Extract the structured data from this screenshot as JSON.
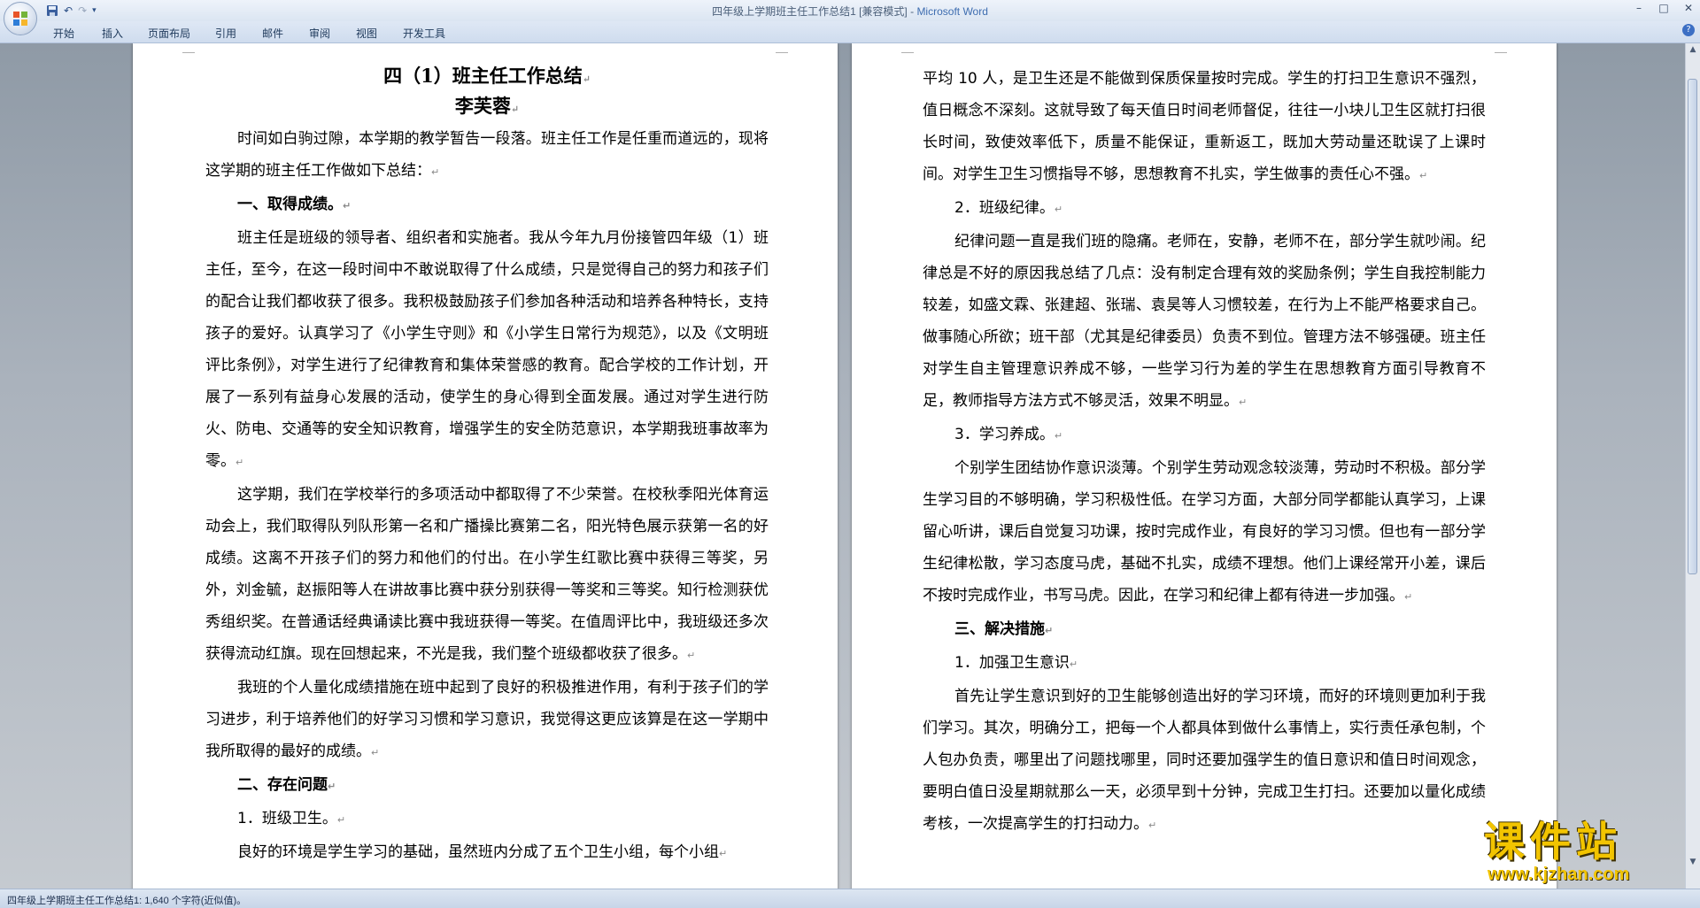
{
  "window": {
    "title": "四年级上学期班主任工作总结1 [兼容模式] - ",
    "app_name": "Microsoft Word",
    "controls": [
      "–",
      "□",
      "✕"
    ]
  },
  "quick_access": {
    "save_icon": "save-icon",
    "undo_icon": "undo-icon",
    "redo_icon": "redo-icon",
    "customize_icon": "customize-qat-icon"
  },
  "ribbon_tabs": [
    "开始",
    "插入",
    "页面布局",
    "引用",
    "邮件",
    "审阅",
    "视图",
    "开发工具"
  ],
  "document": {
    "left_page": {
      "title": "四（1）班主任工作总结",
      "author": "李芙蓉",
      "blocks": [
        {
          "type": "p",
          "text": "时间如白驹过隙，本学期的教学暂告一段落。班主任工作是任重而道远的，现将这学期的班主任工作做如下总结："
        },
        {
          "type": "h",
          "text": "一、取得成绩。"
        },
        {
          "type": "p",
          "text": "班主任是班级的领导者、组织者和实施者。我从今年九月份接管四年级（1）班主任，至今，在这一段时间中不敢说取得了什么成绩，只是觉得自己的努力和孩子们的配合让我们都收获了很多。我积极鼓励孩子们参加各种活动和培养各种特长，支持孩子的爱好。认真学习了《小学生守则》和《小学生日常行为规范》，以及《文明班评比条例》，对学生进行了纪律教育和集体荣誉感的教育。配合学校的工作计划，开展了一系列有益身心发展的活动，使学生的身心得到全面发展。通过对学生进行防火、防电、交通等的安全知识教育，增强学生的安全防范意识，本学期我班事故率为零。"
        },
        {
          "type": "p",
          "text": "这学期，我们在学校举行的多项活动中都取得了不少荣誉。在校秋季阳光体育运动会上，我们取得队列队形第一名和广播操比赛第二名，阳光特色展示获第一名的好成绩。这离不开孩子们的努力和他们的付出。在小学生红歌比赛中获得三等奖，另外，刘金毓，赵振阳等人在讲故事比赛中获分别获得一等奖和三等奖。知行检测获优秀组织奖。在普通话经典诵读比赛中我班获得一等奖。在值周评比中，我班级还多次获得流动红旗。现在回想起来，不光是我，我们整个班级都收获了很多。"
        },
        {
          "type": "p",
          "text": "我班的个人量化成绩措施在班中起到了良好的积极推进作用，有利于孩子们的学习进步，利于培养他们的好学习习惯和学习意识，我觉得这更应该算是在这一学期中我所取得的最好的成绩。"
        },
        {
          "type": "h",
          "text": "二、存在问题"
        },
        {
          "type": "h2",
          "text": "1．班级卫生。"
        },
        {
          "type": "p",
          "text": "良好的环境是学生学习的基础，虽然班内分成了五个卫生小组，每个小组"
        }
      ]
    },
    "right_page": {
      "blocks": [
        {
          "type": "p0",
          "text": "平均 10 人，是卫生还是不能做到保质保量按时完成。学生的打扫卫生意识不强烈，值日概念不深刻。这就导致了每天值日时间老师督促，往往一小块儿卫生区就打扫很长时间，致使效率低下，质量不能保证，重新返工，既加大劳动量还耽误了上课时间。对学生卫生习惯指导不够，思想教育不扎实，学生做事的责任心不强。"
        },
        {
          "type": "h2",
          "text": "2．班级纪律。"
        },
        {
          "type": "p",
          "text": "纪律问题一直是我们班的隐痛。老师在，安静，老师不在，部分学生就吵闹。纪律总是不好的原因我总结了几点：没有制定合理有效的奖励条例；学生自我控制能力较差，如盛文霖、张建超、张瑞、袁昊等人习惯较差，在行为上不能严格要求自己。做事随心所欲；班干部（尤其是纪律委员）负责不到位。管理方法不够强硬。班主任对学生自主管理意识养成不够，一些学习行为差的学生在思想教育方面引导教育不足，教师指导方法方式不够灵活，效果不明显。"
        },
        {
          "type": "h2",
          "text": "3．学习养成。"
        },
        {
          "type": "p",
          "text": "个别学生团结协作意识淡薄。个别学生劳动观念较淡薄，劳动时不积极。部分学生学习目的不够明确，学习积极性低。在学习方面，大部分同学都能认真学习，上课留心听讲，课后自觉复习功课，按时完成作业，有良好的学习习惯。但也有一部分学生纪律松散，学习态度马虎，基础不扎实，成绩不理想。他们上课经常开小差，课后不按时完成作业，书写马虎。因此，在学习和纪律上都有待进一步加强。"
        },
        {
          "type": "h",
          "text": "三、解决措施"
        },
        {
          "type": "h2",
          "text": "1．加强卫生意识"
        },
        {
          "type": "p",
          "text": "首先让学生意识到好的卫生能够创造出好的学习环境，而好的环境则更加利于我们学习。其次，明确分工，把每一个人都具体到做什么事情上，实行责任承包制，个人包办负责，哪里出了问题找哪里，同时还要加强学生的值日意识和值日时间观念，要明白值日没星期就那么一天，必须早到十分钟，完成卫生打扫。还要加以量化成绩考核，一次提高学生的打扫动力。"
        }
      ]
    }
  },
  "statusbar": {
    "text": "四年级上学期班主任工作总结1: 1,640 个字符(近似值)。"
  },
  "watermark": {
    "chinese": "课件站",
    "url": "www.kjzhan.com"
  }
}
